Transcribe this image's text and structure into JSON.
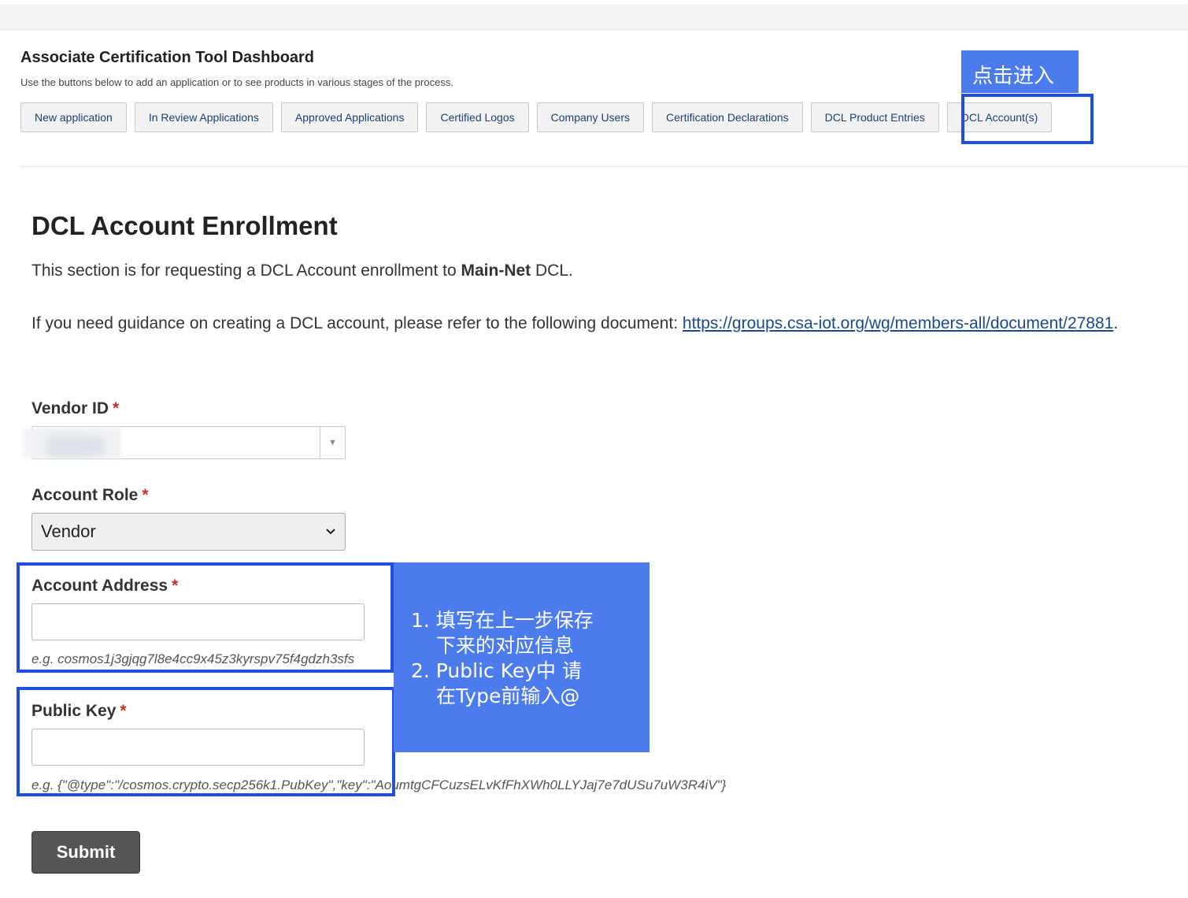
{
  "header": {
    "title": "Associate Certification Tool Dashboard",
    "subtitle": "Use the buttons below to add an application or to see products in various stages of the process."
  },
  "nav": {
    "buttons": [
      {
        "label": "New application"
      },
      {
        "label": "In Review Applications"
      },
      {
        "label": "Approved Applications"
      },
      {
        "label": "Certified Logos"
      },
      {
        "label": "Company Users"
      },
      {
        "label": "Certification Declarations"
      },
      {
        "label": "DCL Product Entries"
      },
      {
        "label": "DCL Account(s)"
      }
    ]
  },
  "annotations": {
    "click_tag": "点击进入",
    "note_lines": [
      "1. 填写在上一步保存",
      "下来的对应信息",
      "2. Public Key中 请",
      "在Type前输入@"
    ],
    "accent_color": "#4b7bec",
    "outline_color": "#1f4fe0"
  },
  "form": {
    "title": "DCL Account Enrollment",
    "intro_prefix": "This section is for requesting a DCL Account enrollment to ",
    "intro_bold": "Main-Net",
    "intro_suffix": " DCL.",
    "guidance_prefix": "If you need guidance on creating a DCL account, please refer to the following document: ",
    "guidance_link": "https://groups.csa-iot.org/wg/members-all/document/27881",
    "guidance_suffix": ".",
    "required_mark": "*",
    "vendor_id": {
      "label": "Vendor ID",
      "arrow_icon": "triangle-down-icon"
    },
    "account_role": {
      "label": "Account Role",
      "value": "Vendor",
      "chevron_icon": "chevron-down-icon"
    },
    "account_address": {
      "label": "Account Address",
      "value": "",
      "hint": "e.g. cosmos1j3gjqg7l8e4cc9x45z3kyrspv75f4gdzh3sfs"
    },
    "public_key": {
      "label": "Public Key",
      "value": "",
      "hint": "e.g. {\"@type\":\"/cosmos.crypto.secp256k1.PubKey\",\"key\":\"AoumtgCFCuzsELvKfFhXWh0LLYJaj7e7dUSu7uW3R4iV\"}"
    },
    "submit_label": "Submit"
  }
}
